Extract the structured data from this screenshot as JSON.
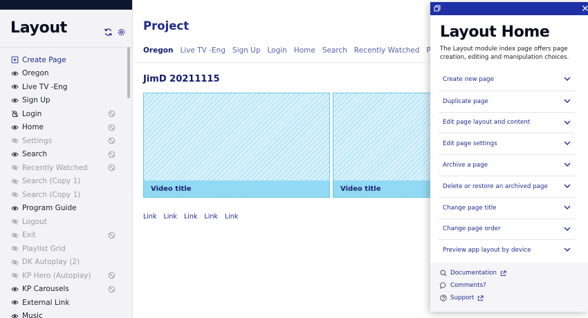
{
  "sidebar": {
    "title": "Layout",
    "items": [
      {
        "label": "Create Page",
        "icon": "plus-box-icon",
        "state": "create",
        "trail": ""
      },
      {
        "label": "Oregon",
        "icon": "eye-icon",
        "state": "visible",
        "trail": ""
      },
      {
        "label": "Live TV -Eng",
        "icon": "eye-icon",
        "state": "visible",
        "trail": ""
      },
      {
        "label": "Sign Up",
        "icon": "eye-icon",
        "state": "visible",
        "trail": ""
      },
      {
        "label": "Login",
        "icon": "lock-off-icon",
        "state": "visible",
        "trail": "disabled-icon"
      },
      {
        "label": "Home",
        "icon": "eye-icon",
        "state": "visible",
        "trail": "disabled-icon"
      },
      {
        "label": "Settings",
        "icon": "eye-off-icon",
        "state": "dim",
        "trail": "disabled-icon"
      },
      {
        "label": "Search",
        "icon": "eye-icon",
        "state": "visible",
        "trail": "disabled-icon"
      },
      {
        "label": "Recently Watched",
        "icon": "eye-off-icon",
        "state": "dim",
        "trail": "disabled-icon"
      },
      {
        "label": "Search (Copy 1)",
        "icon": "eye-off-icon",
        "state": "dim",
        "trail": ""
      },
      {
        "label": "Search (Copy 1)",
        "icon": "eye-off-icon",
        "state": "dim",
        "trail": ""
      },
      {
        "label": "Program Guide",
        "icon": "eye-icon",
        "state": "visible",
        "trail": ""
      },
      {
        "label": "Logout",
        "icon": "eye-off-icon",
        "state": "dim",
        "trail": ""
      },
      {
        "label": "Exit",
        "icon": "eye-off-icon",
        "state": "dim",
        "trail": "disabled-icon"
      },
      {
        "label": "Playlist Grid",
        "icon": "eye-off-icon",
        "state": "dim",
        "trail": ""
      },
      {
        "label": "DK Autoplay (2)",
        "icon": "eye-off-icon",
        "state": "dim",
        "trail": ""
      },
      {
        "label": "KP Hero (Autoplay)",
        "icon": "eye-off-icon",
        "state": "dim",
        "trail": "disabled-icon"
      },
      {
        "label": "KP Carousels",
        "icon": "eye-icon",
        "state": "visible",
        "trail": "disabled-icon"
      },
      {
        "label": "External Link",
        "icon": "eye-icon",
        "state": "visible",
        "trail": ""
      },
      {
        "label": "Music",
        "icon": "eye-icon",
        "state": "visible",
        "trail": ""
      }
    ]
  },
  "main": {
    "project_title": "Project",
    "tabs": [
      {
        "label": "Oregon",
        "active": true
      },
      {
        "label": "Live TV -Eng",
        "active": false
      },
      {
        "label": "Sign Up",
        "active": false
      },
      {
        "label": "Login",
        "active": false
      },
      {
        "label": "Home",
        "active": false
      },
      {
        "label": "Search",
        "active": false
      },
      {
        "label": "Recently Watched",
        "active": false
      },
      {
        "label": "Program Guide",
        "active": false
      }
    ],
    "row_title": "JimD 20211115",
    "cards": [
      {
        "caption": "Video title"
      },
      {
        "caption": "Video title"
      }
    ],
    "links": [
      "Link",
      "Link",
      "Link",
      "Link",
      "Link"
    ]
  },
  "help_panel": {
    "title": "Layout Home",
    "description": "The Layout module index page offers page creation, editing and manipulation choices.",
    "sections": [
      "Create new page",
      "Duplicate page",
      "Edit page layout and content",
      "Edit page settings",
      "Archive a page",
      "Delete or restore an archived page",
      "Change page title",
      "Change page order",
      "Preview app layout by device"
    ],
    "footer": {
      "documentation": "Documentation",
      "comments": "Comments?",
      "support": "Support"
    }
  },
  "colors": {
    "accent": "#1f2a8c",
    "panel_header": "#1f2fa6",
    "card_border": "#69c6ea",
    "sidebar_bg": "#f3f3f5"
  }
}
